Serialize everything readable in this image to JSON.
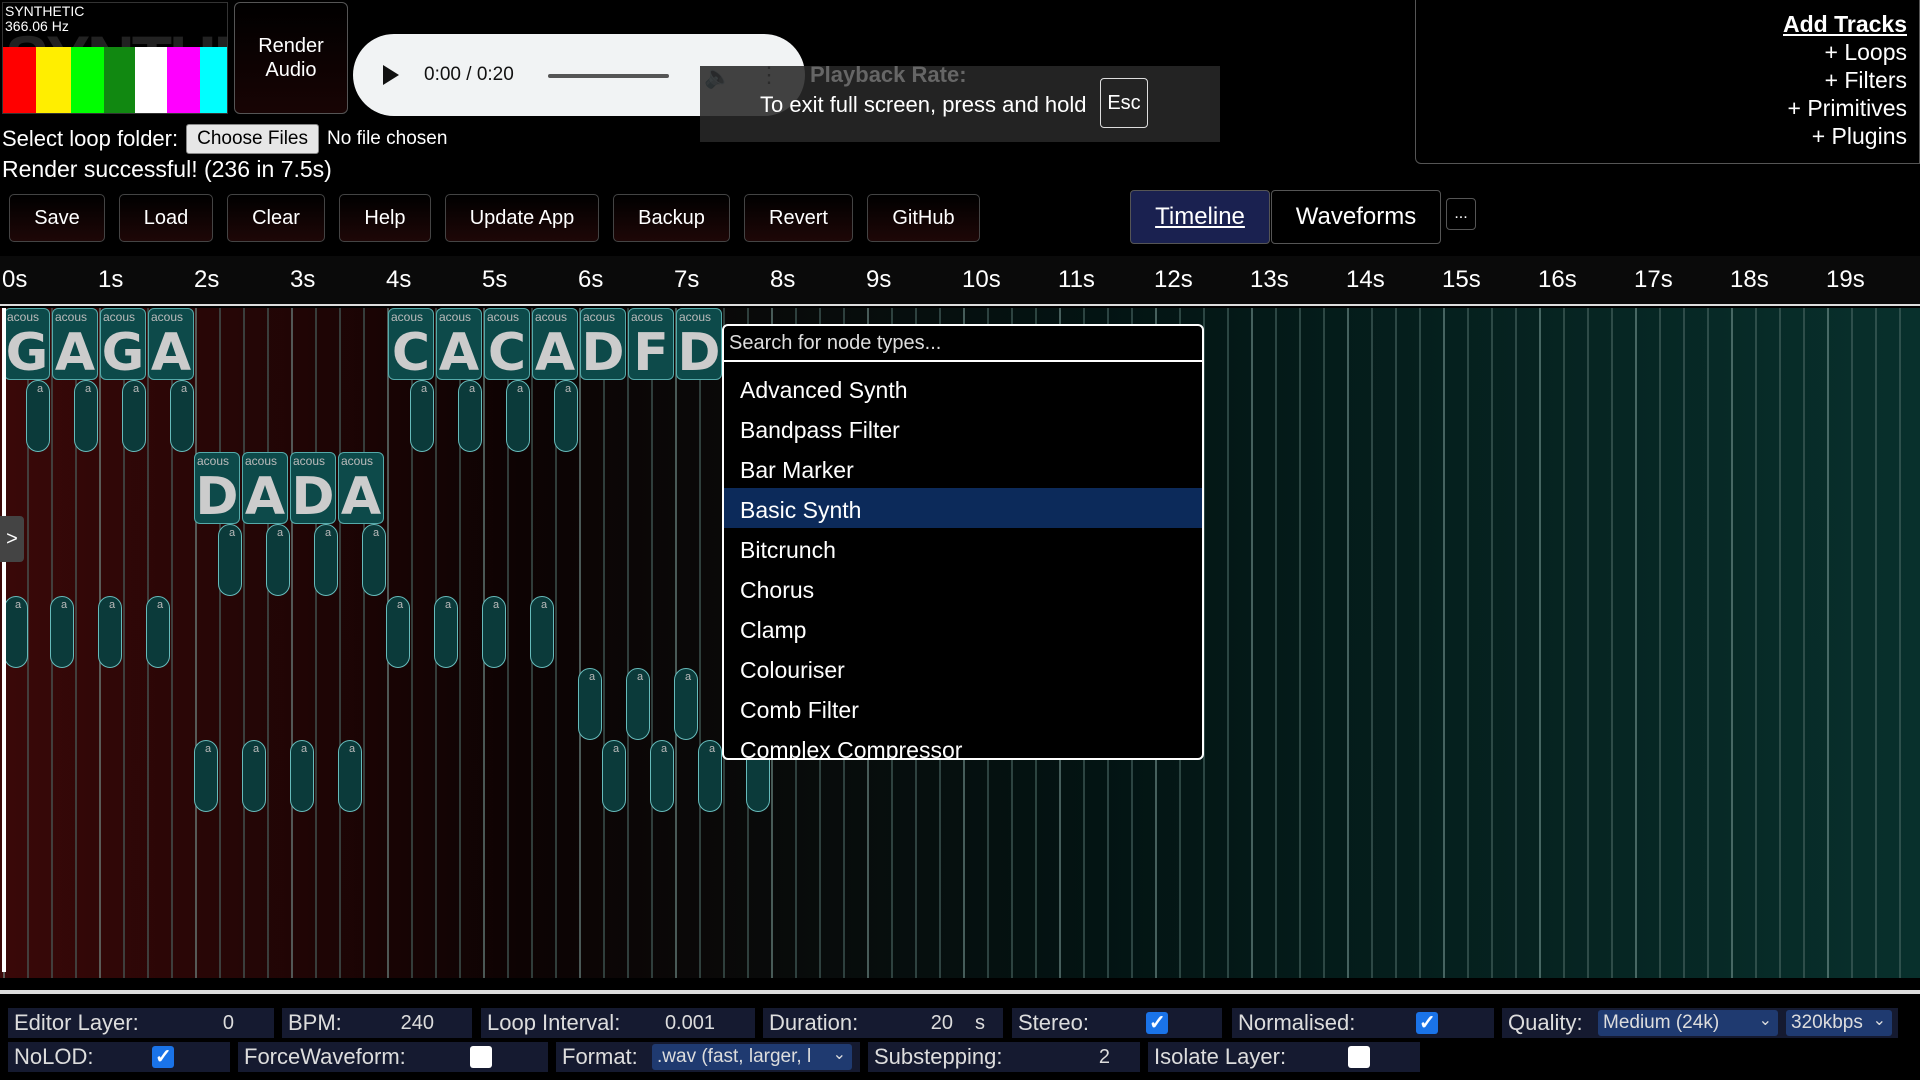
{
  "visualizer": {
    "label": "SYNTHETIC",
    "freq": "366.06 Hz",
    "ghost_text": "SYNTHETIC",
    "bar_colors": [
      "#ff0000",
      "#ffee00",
      "#00ff00",
      "#118811",
      "#ffffff",
      "#ff00ff",
      "#00ffff"
    ]
  },
  "render_button": {
    "label_line1": "Render",
    "label_line2": "Audio"
  },
  "player": {
    "time": "0:00 / 0:20"
  },
  "fullscreen_toast": {
    "playback_rate": "Playback Rate:",
    "message": "To exit full screen, press and hold",
    "key": "Esc"
  },
  "loop_folder": {
    "label": "Select loop folder:",
    "button": "Choose Files",
    "file_status": "No file chosen"
  },
  "render_status": "Render successful! (236 in 7.5s)",
  "add_tracks": {
    "heading": "Add Tracks",
    "items": [
      "+ Loops",
      "+ Filters",
      "+ Primitives",
      "+ Plugins"
    ]
  },
  "toolbar": {
    "buttons": [
      "Save",
      "Load",
      "Clear",
      "Help",
      "Update App",
      "Backup",
      "Revert",
      "GitHub"
    ]
  },
  "tabs": {
    "timeline": "Timeline",
    "waveforms": "Waveforms",
    "more": "..."
  },
  "ruler": {
    "ticks": [
      "0s",
      "1s",
      "2s",
      "3s",
      "4s",
      "5s",
      "6s",
      "7s",
      "8s",
      "9s",
      "10s",
      "11s",
      "12s",
      "13s",
      "14s",
      "15s",
      "16s",
      "17s",
      "18s",
      "19s"
    ]
  },
  "clips": {
    "caption": "acous",
    "pill_caption": "a",
    "row1": [
      "G",
      "A",
      "G",
      "A"
    ],
    "row2": [
      "C",
      "A",
      "C",
      "A",
      "D",
      "F",
      "D"
    ],
    "row3": [
      "D",
      "A",
      "D",
      "A"
    ]
  },
  "side_toggle": ">",
  "node_search": {
    "placeholder": "Search for node types...",
    "options": [
      "Advanced Synth",
      "Bandpass Filter",
      "Bar Marker",
      "Basic Synth",
      "Bitcrunch",
      "Chorus",
      "Clamp",
      "Colouriser",
      "Comb Filter",
      "Complex Compressor"
    ],
    "selected": "Basic Synth"
  },
  "settings": {
    "editor_layer": {
      "label": "Editor Layer:",
      "value": "0"
    },
    "bpm": {
      "label": "BPM:",
      "value": "240"
    },
    "loop_interval": {
      "label": "Loop Interval:",
      "value": "0.001"
    },
    "duration": {
      "label": "Duration:",
      "value": "20",
      "unit": "s"
    },
    "stereo": {
      "label": "Stereo:",
      "checked": true
    },
    "normalised": {
      "label": "Normalised:",
      "checked": true
    },
    "quality": {
      "label": "Quality:",
      "value": "Medium (24k)",
      "bitrate": "320kbps"
    },
    "nolod": {
      "label": "NoLOD:",
      "checked": true
    },
    "force_waveform": {
      "label": "ForceWaveform:",
      "checked": false
    },
    "format": {
      "label": "Format:",
      "value": ".wav (fast, larger, l"
    },
    "substepping": {
      "label": "Substepping:",
      "value": "2"
    },
    "isolate_layer": {
      "label": "Isolate Layer:",
      "checked": false
    }
  }
}
